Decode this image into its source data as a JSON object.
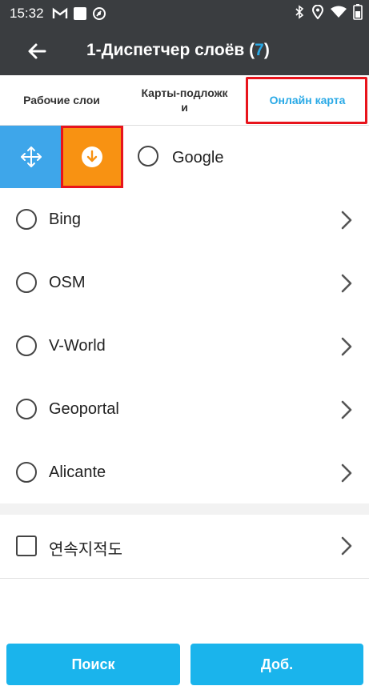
{
  "status_bar": {
    "time": "15:32",
    "left_icons": [
      "gmail-icon",
      "square-notification-icon",
      "sync-circle-icon"
    ],
    "right_icons": [
      "bluetooth-icon",
      "location-icon",
      "wifi-icon",
      "battery-icon"
    ]
  },
  "app_bar": {
    "title_prefix": "1-Диспетчер слоёв (",
    "count": "7",
    "title_suffix": ")"
  },
  "tabs": [
    {
      "label": "Рабочие слои",
      "active": false
    },
    {
      "label": "Карты-подложк\nи",
      "active": false
    },
    {
      "label": "Онлайн карта",
      "active": true
    }
  ],
  "layers": [
    {
      "label": "Google",
      "type": "radio",
      "selected": false
    },
    {
      "label": "Bing",
      "type": "radio",
      "selected": false
    },
    {
      "label": "OSM",
      "type": "radio",
      "selected": false
    },
    {
      "label": "V-World",
      "type": "radio",
      "selected": false
    },
    {
      "label": "Geoportal",
      "type": "radio",
      "selected": false
    },
    {
      "label": "Alicante",
      "type": "radio",
      "selected": false
    },
    {
      "label": "연속지적도",
      "type": "checkbox",
      "checked": false
    }
  ],
  "buttons": {
    "search": "Поиск",
    "add": "Доб."
  },
  "colors": {
    "bar": "#3a3d40",
    "accent": "#29a9e6",
    "button": "#1ab4ec",
    "move_action": "#3ea6ea",
    "download_action": "#f89212",
    "highlight": "#e8141c"
  }
}
